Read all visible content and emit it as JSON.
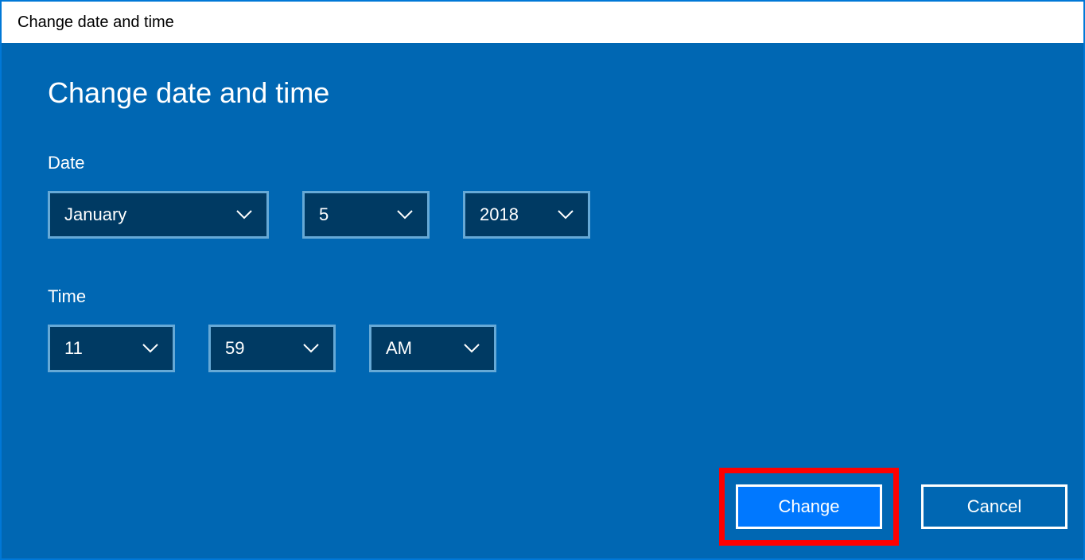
{
  "window": {
    "title": "Change date and time"
  },
  "heading": "Change date and time",
  "labels": {
    "date": "Date",
    "time": "Time"
  },
  "date": {
    "month": "January",
    "day": "5",
    "year": "2018"
  },
  "time": {
    "hour": "11",
    "minute": "59",
    "ampm": "AM"
  },
  "buttons": {
    "change": "Change",
    "cancel": "Cancel"
  }
}
